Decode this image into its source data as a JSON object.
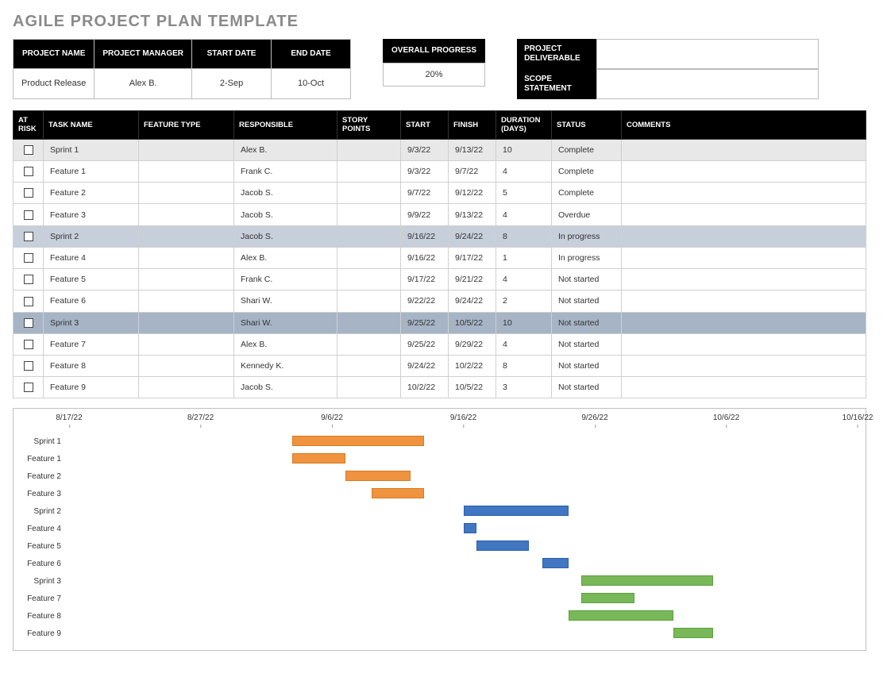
{
  "title": "AGILE PROJECT PLAN TEMPLATE",
  "info_headers": {
    "project_name": "PROJECT NAME",
    "project_manager": "PROJECT MANAGER",
    "start_date": "START DATE",
    "end_date": "END DATE"
  },
  "info_values": {
    "project_name": "Product Release",
    "project_manager": "Alex B.",
    "start_date": "2-Sep",
    "end_date": "10-Oct"
  },
  "overall_progress_label": "OVERALL PROGRESS",
  "overall_progress_value": "20%",
  "project_deliverable_label": "PROJECT DELIVERABLE",
  "project_deliverable_value": "",
  "scope_statement_label": "SCOPE STATEMENT",
  "scope_statement_value": "",
  "columns": {
    "at_risk": "AT RISK",
    "task_name": "TASK NAME",
    "feature_type": "FEATURE TYPE",
    "responsible": "RESPONSIBLE",
    "story_points": "STORY POINTS",
    "start": "START",
    "finish": "FINISH",
    "duration": "DURATION (DAYS)",
    "status": "STATUS",
    "comments": "COMMENTS"
  },
  "rows": [
    {
      "task": "Sprint 1",
      "feature": "",
      "responsible": "Alex B.",
      "story": "",
      "start": "9/3/22",
      "finish": "9/13/22",
      "duration": "10",
      "status": "Complete",
      "comments": "",
      "shade": "shade-1"
    },
    {
      "task": "Feature 1",
      "feature": "",
      "responsible": "Frank C.",
      "story": "",
      "start": "9/3/22",
      "finish": "9/7/22",
      "duration": "4",
      "status": "Complete",
      "comments": "",
      "shade": ""
    },
    {
      "task": "Feature 2",
      "feature": "",
      "responsible": "Jacob S.",
      "story": "",
      "start": "9/7/22",
      "finish": "9/12/22",
      "duration": "5",
      "status": "Complete",
      "comments": "",
      "shade": ""
    },
    {
      "task": "Feature 3",
      "feature": "",
      "responsible": "Jacob S.",
      "story": "",
      "start": "9/9/22",
      "finish": "9/13/22",
      "duration": "4",
      "status": "Overdue",
      "comments": "",
      "shade": ""
    },
    {
      "task": "Sprint 2",
      "feature": "",
      "responsible": "Jacob S.",
      "story": "",
      "start": "9/16/22",
      "finish": "9/24/22",
      "duration": "8",
      "status": "In progress",
      "comments": "",
      "shade": "shade-2"
    },
    {
      "task": "Feature 4",
      "feature": "",
      "responsible": "Alex B.",
      "story": "",
      "start": "9/16/22",
      "finish": "9/17/22",
      "duration": "1",
      "status": "In progress",
      "comments": "",
      "shade": ""
    },
    {
      "task": "Feature 5",
      "feature": "",
      "responsible": "Frank C.",
      "story": "",
      "start": "9/17/22",
      "finish": "9/21/22",
      "duration": "4",
      "status": "Not started",
      "comments": "",
      "shade": ""
    },
    {
      "task": "Feature 6",
      "feature": "",
      "responsible": "Shari W.",
      "story": "",
      "start": "9/22/22",
      "finish": "9/24/22",
      "duration": "2",
      "status": "Not started",
      "comments": "",
      "shade": ""
    },
    {
      "task": "Sprint 3",
      "feature": "",
      "responsible": "Shari W.",
      "story": "",
      "start": "9/25/22",
      "finish": "10/5/22",
      "duration": "10",
      "status": "Not started",
      "comments": "",
      "shade": "shade-3"
    },
    {
      "task": "Feature 7",
      "feature": "",
      "responsible": "Alex B.",
      "story": "",
      "start": "9/25/22",
      "finish": "9/29/22",
      "duration": "4",
      "status": "Not started",
      "comments": "",
      "shade": ""
    },
    {
      "task": "Feature 8",
      "feature": "",
      "responsible": "Kennedy K.",
      "story": "",
      "start": "9/24/22",
      "finish": "10/2/22",
      "duration": "8",
      "status": "Not started",
      "comments": "",
      "shade": ""
    },
    {
      "task": "Feature 9",
      "feature": "",
      "responsible": "Jacob S.",
      "story": "",
      "start": "10/2/22",
      "finish": "10/5/22",
      "duration": "3",
      "status": "Not started",
      "comments": "",
      "shade": ""
    }
  ],
  "chart_data": {
    "type": "bar",
    "title": "",
    "x_axis_type": "date",
    "x_min": "8/17/22",
    "x_max": "10/16/22",
    "x_ticks": [
      "8/17/22",
      "8/27/22",
      "9/6/22",
      "9/16/22",
      "9/26/22",
      "10/6/22",
      "10/16/22"
    ],
    "series": [
      {
        "name": "Sprint 1",
        "start": "9/3/22",
        "end": "9/13/22",
        "color": "orange"
      },
      {
        "name": "Feature 1",
        "start": "9/3/22",
        "end": "9/7/22",
        "color": "orange"
      },
      {
        "name": "Feature 2",
        "start": "9/7/22",
        "end": "9/12/22",
        "color": "orange"
      },
      {
        "name": "Feature 3",
        "start": "9/9/22",
        "end": "9/13/22",
        "color": "orange"
      },
      {
        "name": "Sprint 2",
        "start": "9/16/22",
        "end": "9/24/22",
        "color": "blue"
      },
      {
        "name": "Feature 4",
        "start": "9/16/22",
        "end": "9/17/22",
        "color": "blue"
      },
      {
        "name": "Feature 5",
        "start": "9/17/22",
        "end": "9/21/22",
        "color": "blue"
      },
      {
        "name": "Feature 6",
        "start": "9/22/22",
        "end": "9/24/22",
        "color": "blue"
      },
      {
        "name": "Sprint 3",
        "start": "9/25/22",
        "end": "10/5/22",
        "color": "green"
      },
      {
        "name": "Feature 7",
        "start": "9/25/22",
        "end": "9/29/22",
        "color": "green"
      },
      {
        "name": "Feature 8",
        "start": "9/24/22",
        "end": "10/2/22",
        "color": "green"
      },
      {
        "name": "Feature 9",
        "start": "10/2/22",
        "end": "10/5/22",
        "color": "green"
      }
    ]
  }
}
